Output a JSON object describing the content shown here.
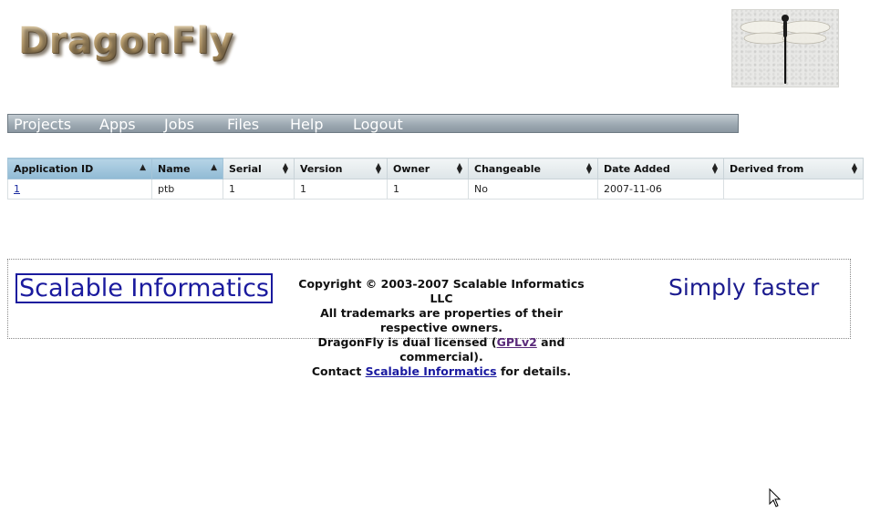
{
  "brand": {
    "logo_text": "DragonFly"
  },
  "nav": {
    "items": [
      {
        "label": "Projects"
      },
      {
        "label": "Apps"
      },
      {
        "label": "Jobs"
      },
      {
        "label": "Files"
      },
      {
        "label": "Help"
      },
      {
        "label": "Logout"
      }
    ]
  },
  "table": {
    "columns": [
      {
        "label": "Application ID",
        "sorted": "asc"
      },
      {
        "label": "Name",
        "sorted": "asc"
      },
      {
        "label": "Serial",
        "sorted": "none"
      },
      {
        "label": "Version",
        "sorted": "none"
      },
      {
        "label": "Owner",
        "sorted": "none"
      },
      {
        "label": "Changeable",
        "sorted": "none"
      },
      {
        "label": "Date Added",
        "sorted": "none"
      },
      {
        "label": "Derived from",
        "sorted": "none"
      }
    ],
    "rows": [
      [
        "1",
        "ptb",
        "1",
        "1",
        "1",
        "No",
        "2007-11-06",
        ""
      ]
    ]
  },
  "footer": {
    "company_logo": "Scalable Informatics",
    "line1": "Copyright © 2003-2007 Scalable Informatics LLC",
    "line2": "All trademarks are properties of their respective owners.",
    "line3_pre": "DragonFly is dual licensed (",
    "line3_link": "GPLv2",
    "line3_post": " and commercial).",
    "line4_pre": "Contact ",
    "line4_link": "Scalable Informatics",
    "line4_post": " for details.",
    "tagline": "Simply faster"
  },
  "colors": {
    "nav_bg": "#9eaab3",
    "header_active": "#90bad4",
    "link": "#1a1aa0",
    "brand_blue": "#1a1a9e"
  }
}
